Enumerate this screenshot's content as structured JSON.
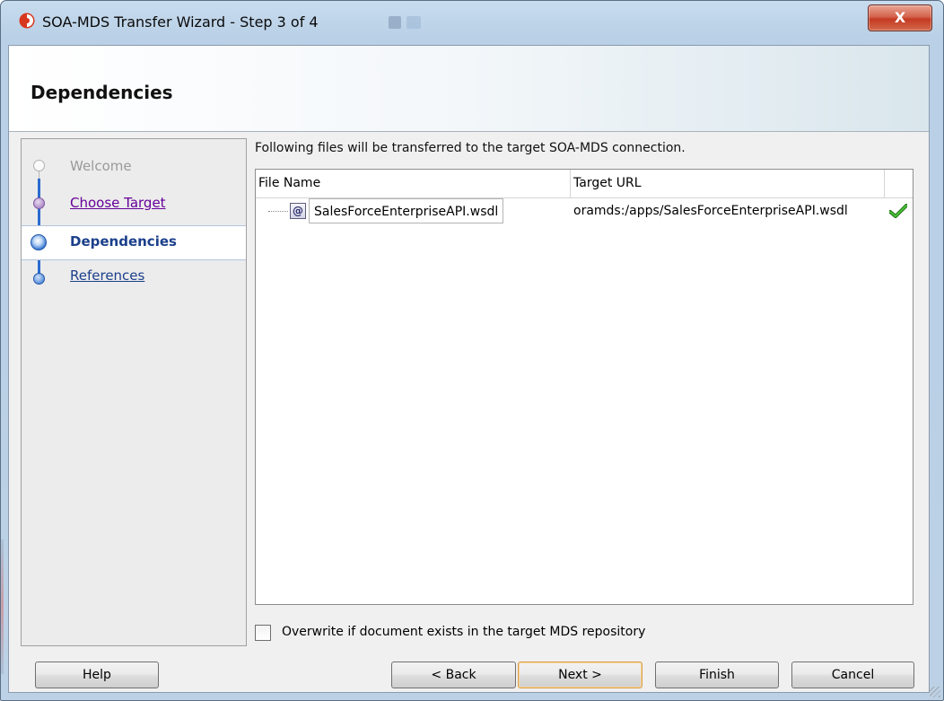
{
  "window": {
    "title": "SOA-MDS Transfer Wizard - Step 3 of 4",
    "close_label": "X"
  },
  "header": {
    "title": "Dependencies"
  },
  "nav": {
    "items": [
      {
        "label": "Welcome",
        "state": "disabled"
      },
      {
        "label": "Choose Target",
        "state": "visited"
      },
      {
        "label": "Dependencies",
        "state": "current"
      },
      {
        "label": "References",
        "state": "link"
      }
    ]
  },
  "main": {
    "intro": "Following files will be transferred to the target SOA-MDS connection.",
    "table": {
      "columns": [
        "File Name",
        "Target URL",
        ""
      ],
      "rows": [
        {
          "icon": "@",
          "file_name": "SalesForceEnterpriseAPI.wsdl",
          "target_url": "oramds:/apps/SalesForceEnterpriseAPI.wsdl",
          "status": "check-icon"
        }
      ]
    },
    "overwrite": {
      "label": "Overwrite if document exists in the target MDS repository",
      "checked": false
    }
  },
  "buttons": {
    "help": "Help",
    "back": "< Back",
    "next": "Next >",
    "finish": "Finish",
    "cancel": "Cancel"
  },
  "colors": {
    "link": "#1b3f8b",
    "visited": "#660099",
    "check": "#2e9a1e",
    "default_button_border": "#d89e4a"
  }
}
